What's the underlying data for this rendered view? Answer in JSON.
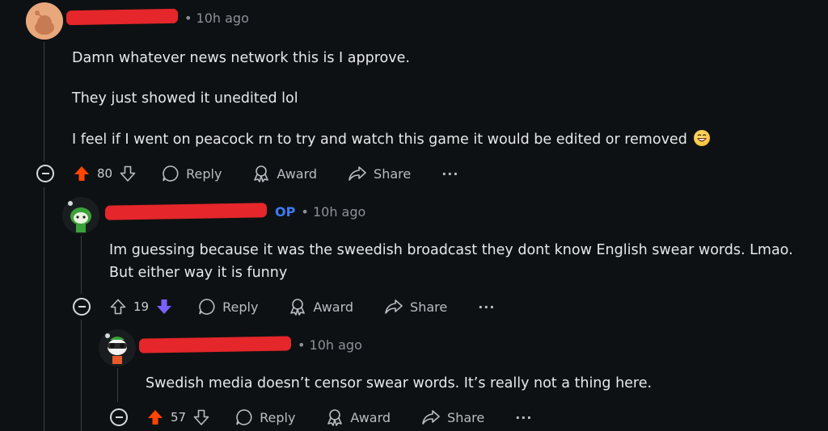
{
  "colors": {
    "background": "#0e1113",
    "upvote_active": "#ff4500",
    "downvote_active": "#7a60ff",
    "op_badge": "#3d7bf2",
    "redaction": "#e5262a"
  },
  "comments": [
    {
      "separator": "•",
      "time": "10h ago",
      "paragraphs": [
        "Damn whatever news network this is I approve.",
        "They just showed it unedited lol",
        "I feel if I went on peacock rn to try and watch this game it would be edited or removed"
      ],
      "trailing_icon": "laughing-emoji-icon",
      "score": "80",
      "vote_state": "upvoted",
      "actions": {
        "reply": "Reply",
        "award": "Award",
        "share": "Share",
        "more": "···"
      }
    },
    {
      "op_label": "OP",
      "separator": "•",
      "time": "10h ago",
      "paragraphs": [
        "Im guessing because it was the sweedish broadcast they dont know English swear words. Lmao. But either way it is funny"
      ],
      "score": "19",
      "vote_state": "downvoted",
      "actions": {
        "reply": "Reply",
        "award": "Award",
        "share": "Share",
        "more": "···"
      }
    },
    {
      "separator": "•",
      "time": "10h ago",
      "paragraphs": [
        "Swedish media doesn’t censor swear words. It’s really not a thing here."
      ],
      "score": "57",
      "vote_state": "upvoted",
      "actions": {
        "reply": "Reply",
        "award": "Award",
        "share": "Share",
        "more": "···"
      }
    }
  ]
}
